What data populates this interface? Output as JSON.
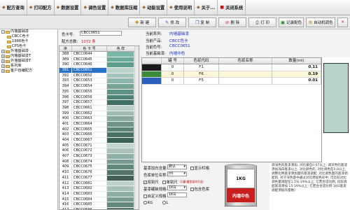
{
  "toolbar": {
    "items": [
      {
        "icon": "formula-query-icon",
        "glyph": "◆",
        "label": "配方查询"
      },
      {
        "icon": "print-formula-icon",
        "glyph": "◆",
        "label": "打印配方"
      },
      {
        "icon": "data-settings-icon",
        "glyph": "◆",
        "label": "数据设置"
      },
      {
        "icon": "color-calibration-icon",
        "glyph": "◆",
        "label": "调色设置"
      },
      {
        "icon": "database-compress-icon",
        "glyph": "◆",
        "label": "数据库压缩"
      },
      {
        "icon": "system-settings-icon",
        "glyph": "◆",
        "label": "动能设置"
      },
      {
        "icon": "help-icon",
        "glyph": "◆",
        "label": "使用说明"
      },
      {
        "icon": "about-icon",
        "glyph": "◆",
        "label": "关于..."
      },
      {
        "icon": "close-system-icon",
        "glyph": "■",
        "label": "关闭系统"
      }
    ]
  },
  "actions": {
    "new": "新 建",
    "edit": "修 改",
    "copy": "复 制",
    "delete": "删 除",
    "print": "打 印",
    "record_formula": "记录配色",
    "auto_dispense": "自动机调色",
    "exit_glyph": "✕"
  },
  "tree": {
    "items": [
      {
        "label": "内墙基础漆",
        "level": 0,
        "expanded": true
      },
      {
        "label": "CBCC色卡",
        "level": 1
      },
      {
        "label": "1988色卡",
        "level": 1
      },
      {
        "label": "CPS色卡",
        "level": 1
      },
      {
        "label": "外墙基础漆",
        "level": 0
      },
      {
        "label": "内墙基础漆T",
        "level": 0
      },
      {
        "label": "外墙基础漆T",
        "level": 0
      },
      {
        "label": "系列库",
        "level": 0
      },
      {
        "label": "客户自编配方",
        "level": 0
      }
    ]
  },
  "formula_list": {
    "color_number_label": "色卡号:",
    "color_number_value": "CBCC0651",
    "total_label": "配方总数:",
    "total_value": "1072 条",
    "headers": [
      "序",
      "色 卡 号",
      "色 样"
    ],
    "rows": [
      {
        "n": "388",
        "code": "CBCC0644",
        "color": "#79b7a8"
      },
      {
        "n": "389",
        "code": "CBCC0645",
        "color": "#6aa99a"
      },
      {
        "n": "390",
        "code": "CBCC0646",
        "color": "#5d9e8e"
      },
      {
        "n": "391",
        "code": "CBCC0651",
        "color": "#b9d2cc"
      },
      {
        "n": "392",
        "code": "CBCC0652",
        "color": "#a3c4bc"
      },
      {
        "n": "393",
        "code": "CBCC0653",
        "color": "#8db5ab"
      },
      {
        "n": "394",
        "code": "CBCC0654",
        "color": "#77a598"
      },
      {
        "n": "395",
        "code": "CBCC0655",
        "color": "#5f9385"
      },
      {
        "n": "396",
        "code": "CBCC0656",
        "color": "#4d8274"
      },
      {
        "n": "397",
        "code": "CBCC0657",
        "color": "#3e7163"
      },
      {
        "n": "398",
        "code": "CBCC0661",
        "color": "#b7cfc8"
      },
      {
        "n": "399",
        "code": "CBCC0662",
        "color": "#9fbcb3"
      },
      {
        "n": "400",
        "code": "CBCC0663",
        "color": "#87a89e"
      },
      {
        "n": "401",
        "code": "CBCC0664",
        "color": "#6f958a"
      },
      {
        "n": "402",
        "code": "CBCC0665",
        "color": "#5c8377"
      },
      {
        "n": "403",
        "code": "CBCC0666",
        "color": "#4a7165"
      },
      {
        "n": "404",
        "code": "CBCC0667",
        "color": "#3a5f54"
      },
      {
        "n": "405",
        "code": "CBCC0671",
        "color": "#c2d6d1"
      },
      {
        "n": "406",
        "code": "CBCC0672",
        "color": "#a9c3bc"
      },
      {
        "n": "407",
        "code": "CBCC0673",
        "color": "#8fb0a8"
      },
      {
        "n": "408",
        "code": "CBCC0674",
        "color": "#779b92"
      },
      {
        "n": "409",
        "code": "CBCC0675",
        "color": "#62877d"
      },
      {
        "n": "410",
        "code": "CBCC0676",
        "color": "#507469"
      },
      {
        "n": "411",
        "code": "CBCC0677",
        "color": "#405f56"
      },
      {
        "n": "412",
        "code": "CBCC0681",
        "color": "#bcd2cb"
      },
      {
        "n": "413",
        "code": "CBCC0682",
        "color": "#a5c1b8"
      },
      {
        "n": "414",
        "code": "CBCC0683",
        "color": "#8daea4"
      },
      {
        "n": "415",
        "code": "CBCC0684",
        "color": "#789b90"
      },
      {
        "n": "416",
        "code": "CBCC0685",
        "color": "#64887c"
      },
      {
        "n": "417",
        "code": "CBCC0686",
        "color": "#527468"
      }
    ],
    "selected_index": 3
  },
  "info": {
    "series_label": "当前系列:",
    "series_value": "内墙基础漆",
    "product_label": "当前产品:",
    "product_value": "CBCC色卡",
    "code_label": "当前色号:",
    "code_value": "CBCC0651",
    "base_label": "当前基础漆:",
    "base_value": "内墙中色"
  },
  "formula_table": {
    "headers": [
      "罐 号",
      "色浆代码",
      "色浆名称",
      "数量(ml)"
    ],
    "rows": [
      {
        "can": "0",
        "code": "F1",
        "name": "",
        "qty": "0.11",
        "swatch": "#1a1a1a"
      },
      {
        "can": "0",
        "code": "F6",
        "name": "",
        "qty": "0.19",
        "swatch": "#3a8a3a"
      },
      {
        "can": "0",
        "code": "F5",
        "name": "",
        "qty": "0.01",
        "swatch": "#2a5fc0"
      }
    ]
  },
  "preview": {
    "color": "#b7d3cc"
  },
  "settings": {
    "base_white_label": "基漆加白含量:",
    "base_white_value": "默认",
    "display_grid_label": "显示栏格",
    "paste_unit_label": "色浆单位名称:",
    "paste_unit_value": "ml",
    "dual_scale_label": "双刻尺",
    "single_scale_label": "单刻尺",
    "warn_label": "(1罐-罐里面的1组)",
    "bucket_label": "基漆罐装规格:",
    "bucket_value": "1KG",
    "bucket_color_label": "包含色浆",
    "custom_label": "自定义规格",
    "custom_value": "1KG",
    "unit_kg": "KG",
    "unit_l": "L"
  },
  "can": {
    "capacity": "1KG",
    "base": "内墙中色"
  },
  "note": {
    "text": "调浅色的基漆添加, 对比谨在0.07以上, 调深色的基漆添加浅白基漆以上, 对比颜色的, 对比调色在0.0以上, 调整比例基漆添加量的基漆调配, 对比调色量的基漆调配的, 对于深色基中通过对比添加色彩中, 可比较对比调色量调配在1.5%-19%以上, 亿若合适比例, 比较调配基漆添加 15-19%以上: 亿若合合适比例 1KG基漆调配添加的量数)"
  }
}
